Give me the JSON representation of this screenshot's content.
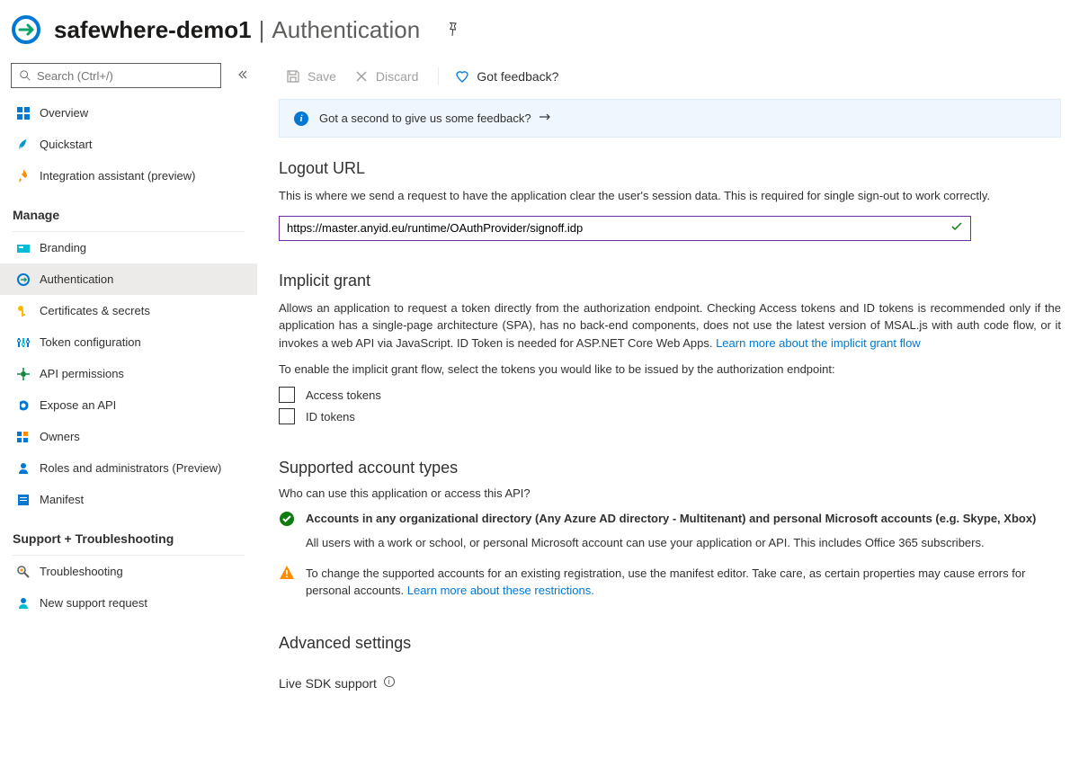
{
  "header": {
    "app_name": "safewhere-demo1",
    "sep": "|",
    "page": "Authentication"
  },
  "sidebar": {
    "search_placeholder": "Search (Ctrl+/)",
    "items_top": [
      {
        "label": "Overview"
      },
      {
        "label": "Quickstart"
      },
      {
        "label": "Integration assistant (preview)"
      }
    ],
    "manage_heading": "Manage",
    "manage_items": [
      {
        "label": "Branding"
      },
      {
        "label": "Authentication",
        "active": true
      },
      {
        "label": "Certificates & secrets"
      },
      {
        "label": "Token configuration"
      },
      {
        "label": "API permissions"
      },
      {
        "label": "Expose an API"
      },
      {
        "label": "Owners"
      },
      {
        "label": "Roles and administrators (Preview)"
      },
      {
        "label": "Manifest"
      }
    ],
    "support_heading": "Support + Troubleshooting",
    "support_items": [
      {
        "label": "Troubleshooting"
      },
      {
        "label": "New support request"
      }
    ]
  },
  "toolbar": {
    "save": "Save",
    "discard": "Discard",
    "feedback": "Got feedback?"
  },
  "banner": {
    "text": "Got a second to give us some feedback?"
  },
  "logout": {
    "title": "Logout URL",
    "desc": "This is where we send a request to have the application clear the user's session data. This is required for single sign-out to work correctly.",
    "value": "https://master.anyid.eu/runtime/OAuthProvider/signoff.idp"
  },
  "implicit": {
    "title": "Implicit grant",
    "desc": "Allows an application to request a token directly from the authorization endpoint. Checking Access tokens and ID tokens is recommended only if the application has a single-page architecture (SPA), has no back-end components, does not use the latest version of MSAL.js with auth code flow, or it invokes a web API via JavaScript. ID Token is needed for ASP.NET Core Web Apps. ",
    "link": "Learn more about the implicit grant flow",
    "enable_text": "To enable the implicit grant flow, select the tokens you would like to be issued by the authorization endpoint:",
    "access_tokens": "Access tokens",
    "id_tokens": "ID tokens"
  },
  "supported": {
    "title": "Supported account types",
    "who": "Who can use this application or access this API?",
    "opt1_title": "Accounts in any organizational directory (Any Azure AD directory - Multitenant) and personal Microsoft accounts (e.g. Skype, Xbox)",
    "opt1_desc": "All users with a work or school, or personal Microsoft account can use your application or API. This includes Office 365 subscribers.",
    "warn_text": "To change the supported accounts for an existing registration, use the manifest editor. Take care, as certain properties may cause errors for personal accounts. ",
    "warn_link": "Learn more about these restrictions."
  },
  "advanced": {
    "title": "Advanced settings",
    "live_sdk": "Live SDK support"
  }
}
